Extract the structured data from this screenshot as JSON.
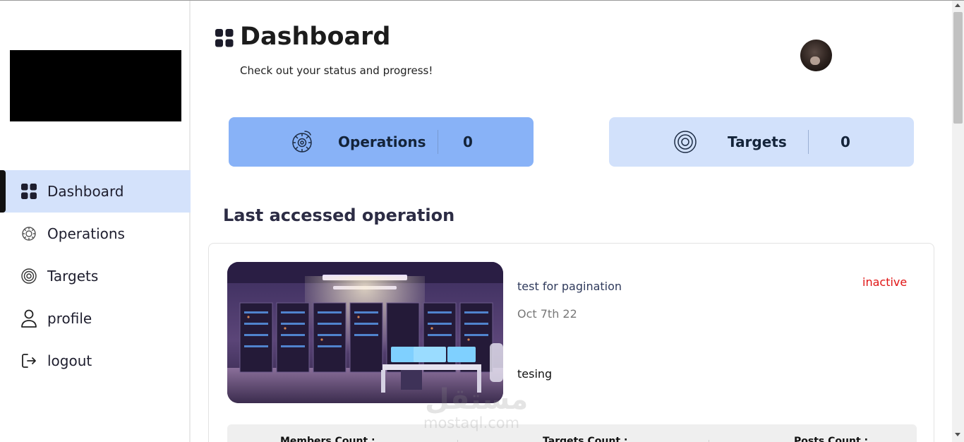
{
  "sidebar": {
    "items": [
      {
        "label": "Dashboard",
        "icon": "grid-icon",
        "active": true
      },
      {
        "label": "Operations",
        "icon": "gear-brain-icon",
        "active": false
      },
      {
        "label": "Targets",
        "icon": "target-icon",
        "active": false
      },
      {
        "label": "profile",
        "icon": "user-icon",
        "active": false
      },
      {
        "label": "logout",
        "icon": "logout-icon",
        "active": false
      }
    ]
  },
  "header": {
    "title": "Dashboard",
    "subtitle": "Check out your status and progress!"
  },
  "stats": {
    "operations": {
      "label": "Operations",
      "value": "0"
    },
    "targets": {
      "label": "Targets",
      "value": "0"
    }
  },
  "last_accessed": {
    "section_title": "Last accessed operation",
    "name": "test for pagination",
    "status": "inactive",
    "date": "Oct 7th 22",
    "description": "tesing",
    "counts": {
      "members_label": "Members Count :",
      "targets_label": "Targets Count :",
      "posts_label": "Posts Count :"
    }
  },
  "watermark": {
    "arabic": "مستقل",
    "latin": "mostaql.com"
  },
  "colors": {
    "accent_active": "#d4e2fb",
    "operations_card": "#88b2f7",
    "targets_card": "#d2e1fb",
    "status_inactive": "#e01414"
  }
}
